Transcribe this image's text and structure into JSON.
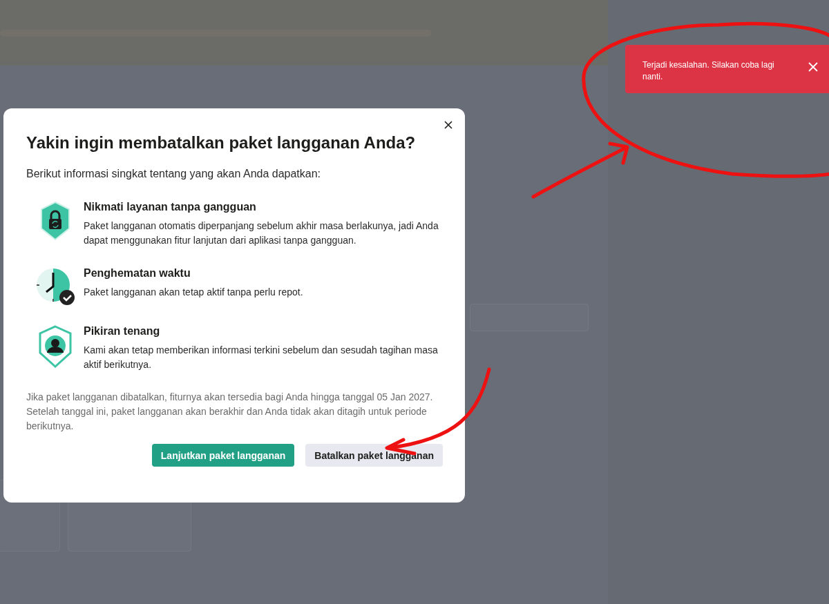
{
  "toast": {
    "kind": "error",
    "message": "Terjadi kesalahan. Silakan coba lagi nanti."
  },
  "dialog": {
    "title": "Yakin ingin membatalkan paket langganan Anda?",
    "intro": "Berikut informasi singkat tentang yang akan Anda dapatkan:",
    "benefits": [
      {
        "kind": "renewal",
        "title": "Nikmati layanan tanpa gangguan",
        "text": "Paket langganan otomatis diperpanjang sebelum akhir masa berlakunya, jadi Anda dapat menggunakan fitur lanjutan dari aplikasi tanpa gangguan."
      },
      {
        "kind": "time",
        "title": "Penghematan waktu",
        "text": "Paket langganan akan tetap aktif tanpa perlu repot."
      },
      {
        "kind": "peace",
        "title": "Pikiran tenang",
        "text": "Kami akan tetap memberikan informasi terkini sebelum dan sesudah tagihan masa aktif berikutnya."
      }
    ],
    "note": "Jika paket langganan dibatalkan, fiturnya akan tersedia bagi Anda hingga tanggal 05 Jan 2027. Setelah tanggal ini, paket langganan akan berakhir dan Anda tidak akan ditagih untuk periode berikutnya.",
    "buttons": [
      {
        "kind": "primary",
        "label": "Lanjutkan paket langganan"
      },
      {
        "kind": "secondary",
        "label": "Batalkan paket langganan"
      }
    ]
  },
  "annotations": [
    {
      "kind": "ellipse"
    },
    {
      "kind": "arrow"
    },
    {
      "kind": "arrow"
    }
  ]
}
